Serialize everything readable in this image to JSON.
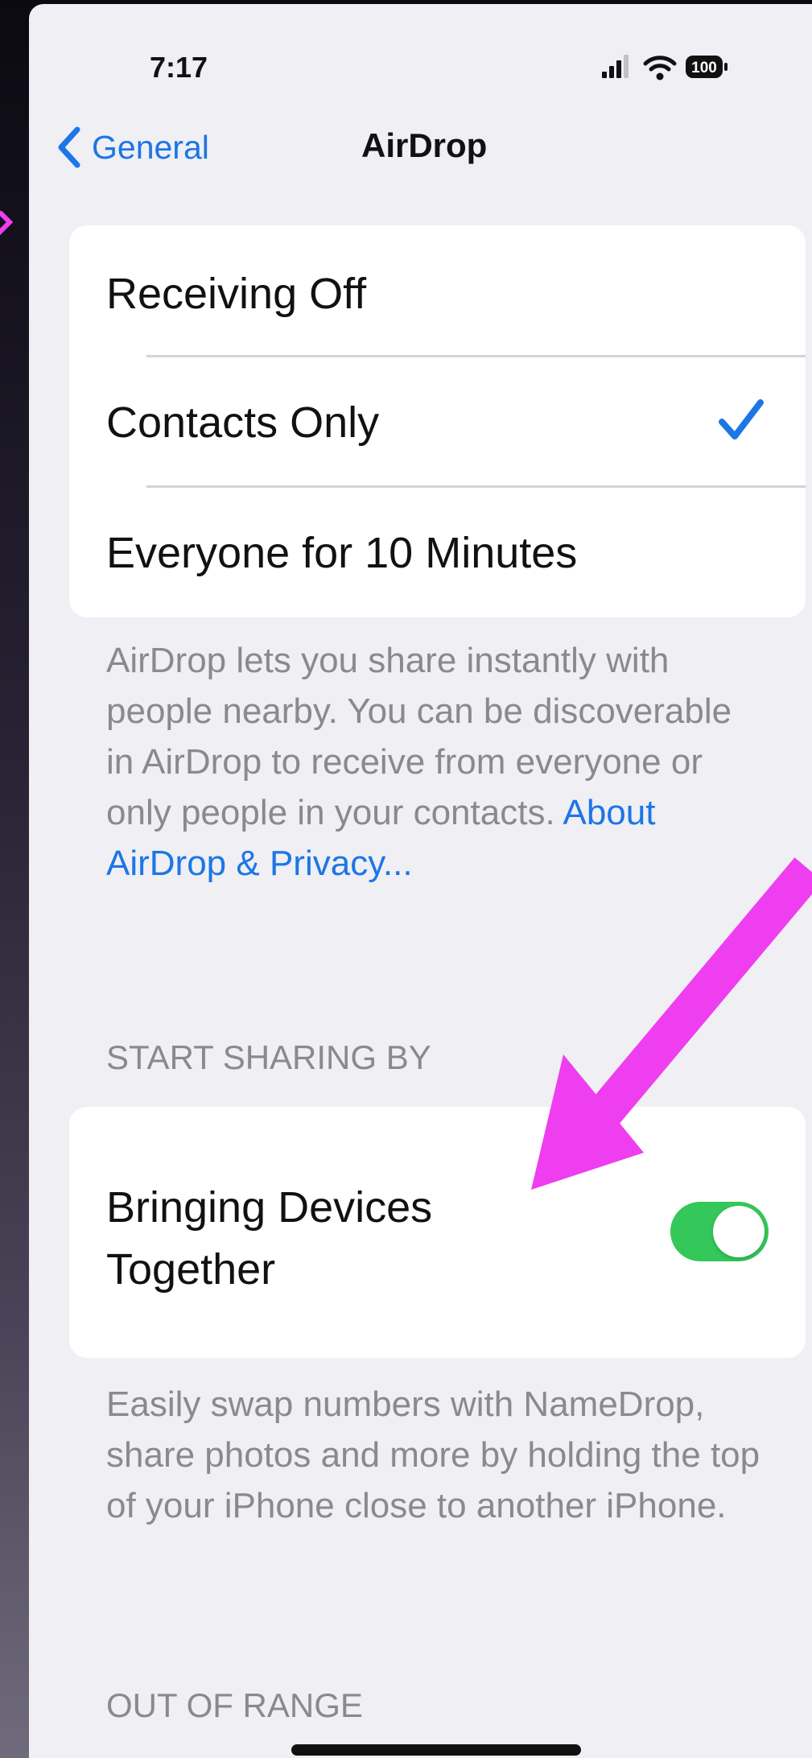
{
  "status_bar": {
    "time": "7:17",
    "battery": "100"
  },
  "nav": {
    "back_label": "General",
    "title": "AirDrop"
  },
  "receiving_options": [
    {
      "label": "Receiving Off",
      "selected": false
    },
    {
      "label": "Contacts Only",
      "selected": true
    },
    {
      "label": "Everyone for 10 Minutes",
      "selected": false
    }
  ],
  "airdrop_description": {
    "text": "AirDrop lets you share instantly with people nearby. You can be discoverable in AirDrop to receive from everyone or only people in your contacts. ",
    "link": "About AirDrop & Privacy..."
  },
  "start_sharing": {
    "header": "START SHARING BY",
    "toggle_label": "Bringing Devices Together",
    "toggle_on": true,
    "description": "Easily swap numbers with NameDrop, share photos and more by holding the top of your iPhone close to another iPhone."
  },
  "out_of_range": {
    "header": "OUT OF RANGE"
  },
  "colors": {
    "accent": "#1c76e6",
    "toggle_on": "#34c759",
    "annotation_arrow": "#ef3ef0",
    "group_background": "#efeff4"
  }
}
